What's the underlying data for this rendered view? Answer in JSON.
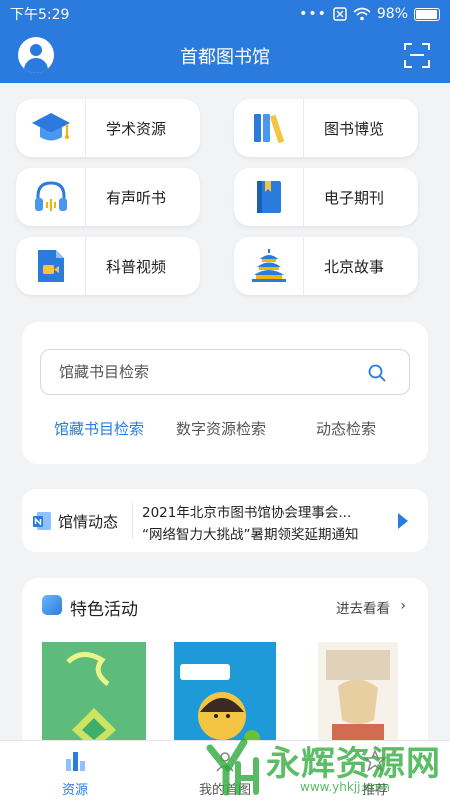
{
  "status_bar": {
    "time": "下午5:29",
    "dots": "•••",
    "battery": "98%"
  },
  "header": {
    "title": "首都图书馆"
  },
  "categories": [
    {
      "label": "学术资源",
      "icon": "graduation-cap-icon"
    },
    {
      "label": "图书博览",
      "icon": "books-icon"
    },
    {
      "label": "有声听书",
      "icon": "headphones-icon"
    },
    {
      "label": "电子期刊",
      "icon": "journal-icon"
    },
    {
      "label": "科普视频",
      "icon": "video-file-icon"
    },
    {
      "label": "北京故事",
      "icon": "temple-of-heaven-icon"
    }
  ],
  "search": {
    "placeholder": "馆藏书目检索",
    "tabs": [
      "馆藏书目检索",
      "数字资源检索",
      "动态检索"
    ],
    "active_tab": 0
  },
  "news": {
    "label": "馆情动态",
    "items": [
      "2021年北京市图书馆协会理事会...",
      "“网络智力大挑战”暑期领奖延期通知"
    ]
  },
  "activities": {
    "title": "特色活动",
    "more": "进去看看"
  },
  "tabbar": {
    "items": [
      "资源",
      "我的首图",
      "推荐"
    ],
    "active": 0
  },
  "watermark": {
    "text": "永辉资源网",
    "url": "www.yhkjj.com"
  },
  "colors": {
    "primary": "#2b7bde",
    "background": "#f2f3f5",
    "watermark": "#2eaa3c"
  }
}
